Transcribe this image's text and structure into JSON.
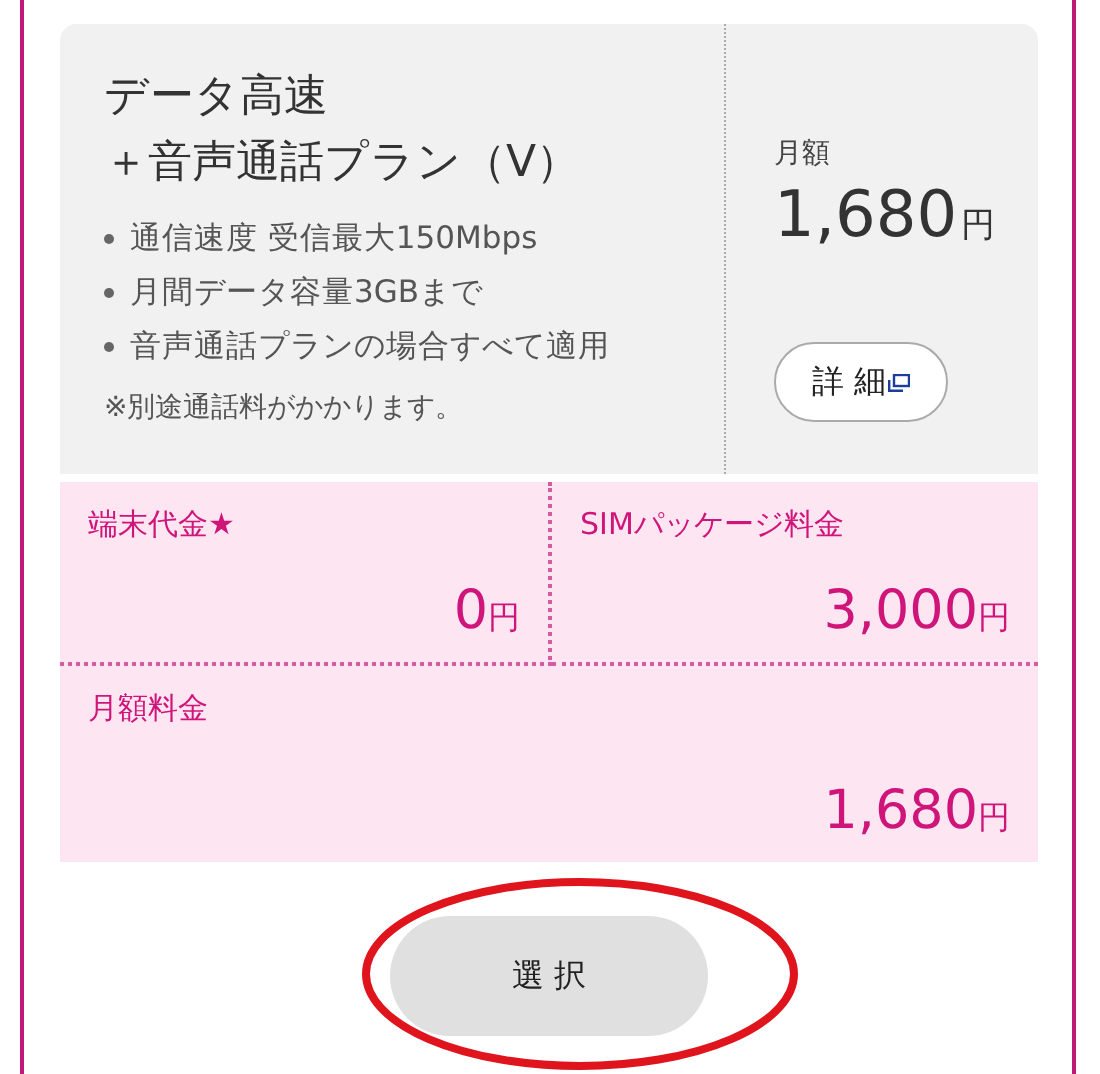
{
  "plan": {
    "title_lines": [
      "データ高速",
      "＋音声通話プラン（V）"
    ],
    "features": [
      "通信速度 受信最大150Mbps",
      "月間データ容量3GBまで",
      "音声通話プランの場合すべて適用"
    ],
    "note": "※別途通話料がかかります。",
    "price_label": "月額",
    "price": "1,680",
    "price_unit": "円",
    "detail_button": "詳 細"
  },
  "fees": [
    {
      "label": "端末代金★",
      "amount": "0",
      "unit": "円"
    },
    {
      "label": "SIMパッケージ料金",
      "amount": "3,000",
      "unit": "円"
    },
    {
      "label": "月額料金",
      "amount": "1,680",
      "unit": "円"
    }
  ],
  "select_button": {
    "label": "選 択",
    "highlighted": true
  }
}
